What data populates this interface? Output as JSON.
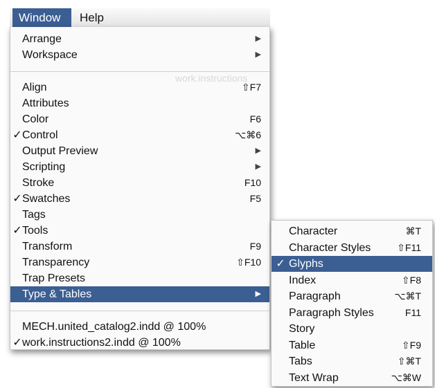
{
  "menubar": {
    "window_label": "Window",
    "help_label": "Help"
  },
  "background_window": {
    "title": "work.instructions"
  },
  "window_menu": [
    {
      "label": "Arrange",
      "shortcut": "",
      "submenu": true,
      "checked": false
    },
    {
      "label": "Workspace",
      "shortcut": "",
      "submenu": true,
      "checked": false
    },
    {
      "separator": true
    },
    {
      "label": "Align",
      "shortcut": "⇧F7",
      "submenu": false,
      "checked": false
    },
    {
      "label": "Attributes",
      "shortcut": "",
      "submenu": false,
      "checked": false
    },
    {
      "label": "Color",
      "shortcut": "F6",
      "submenu": false,
      "checked": false
    },
    {
      "label": "Control",
      "shortcut": "⌥⌘6",
      "submenu": false,
      "checked": true
    },
    {
      "label": "Output Preview",
      "shortcut": "",
      "submenu": true,
      "checked": false
    },
    {
      "label": "Scripting",
      "shortcut": "",
      "submenu": true,
      "checked": false
    },
    {
      "label": "Stroke",
      "shortcut": "F10",
      "submenu": false,
      "checked": false
    },
    {
      "label": "Swatches",
      "shortcut": "F5",
      "submenu": false,
      "checked": true
    },
    {
      "label": "Tags",
      "shortcut": "",
      "submenu": false,
      "checked": false
    },
    {
      "label": "Tools",
      "shortcut": "",
      "submenu": false,
      "checked": true
    },
    {
      "label": "Transform",
      "shortcut": "F9",
      "submenu": false,
      "checked": false
    },
    {
      "label": "Transparency",
      "shortcut": "⇧F10",
      "submenu": false,
      "checked": false
    },
    {
      "label": "Trap Presets",
      "shortcut": "",
      "submenu": false,
      "checked": false
    },
    {
      "label": "Type & Tables",
      "shortcut": "",
      "submenu": true,
      "checked": false,
      "selected": true
    },
    {
      "separator": true
    },
    {
      "label": "MECH.united_catalog2.indd @ 100%",
      "shortcut": "",
      "submenu": false,
      "checked": false
    },
    {
      "label": "work.instructions2.indd @ 100%",
      "shortcut": "",
      "submenu": false,
      "checked": true
    }
  ],
  "type_tables_submenu": [
    {
      "label": "Character",
      "shortcut": "⌘T",
      "checked": false
    },
    {
      "label": "Character Styles",
      "shortcut": "⇧F11",
      "checked": false
    },
    {
      "label": "Glyphs",
      "shortcut": "",
      "checked": true,
      "selected": true
    },
    {
      "label": "Index",
      "shortcut": "⇧F8",
      "checked": false
    },
    {
      "label": "Paragraph",
      "shortcut": "⌥⌘T",
      "checked": false
    },
    {
      "label": "Paragraph Styles",
      "shortcut": "F11",
      "checked": false
    },
    {
      "label": "Story",
      "shortcut": "",
      "checked": false
    },
    {
      "label": "Table",
      "shortcut": "⇧F9",
      "checked": false
    },
    {
      "label": "Tabs",
      "shortcut": "⇧⌘T",
      "checked": false
    },
    {
      "label": "Text Wrap",
      "shortcut": "⌥⌘W",
      "checked": false
    }
  ],
  "check_glyph": "✓",
  "arrow_glyph": "▶",
  "colors": {
    "selection": "#3b5e93",
    "menu_bg": "#fafafa"
  }
}
